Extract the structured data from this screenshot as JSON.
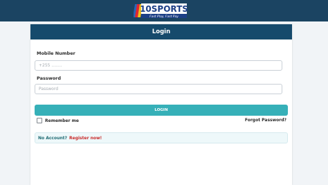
{
  "brand": {
    "name": "10SPORTS",
    "tagline": "Fast Play, Fast Pay"
  },
  "colors": {
    "header": "#1b4462",
    "card_header": "#164a6c",
    "button": "#36b0b8",
    "register_link": "#c92b2b"
  },
  "login": {
    "title": "Login",
    "mobile_label": "Mobile Number",
    "mobile_placeholder": "+255 ........",
    "password_label": "Password",
    "password_placeholder": "Password",
    "submit_label": "LOGIN",
    "remember_label": "Remember me",
    "remember_checked": false,
    "forgot_label": "Forgot Password?",
    "no_account_text": "No Account?",
    "register_label": "Register now!"
  }
}
